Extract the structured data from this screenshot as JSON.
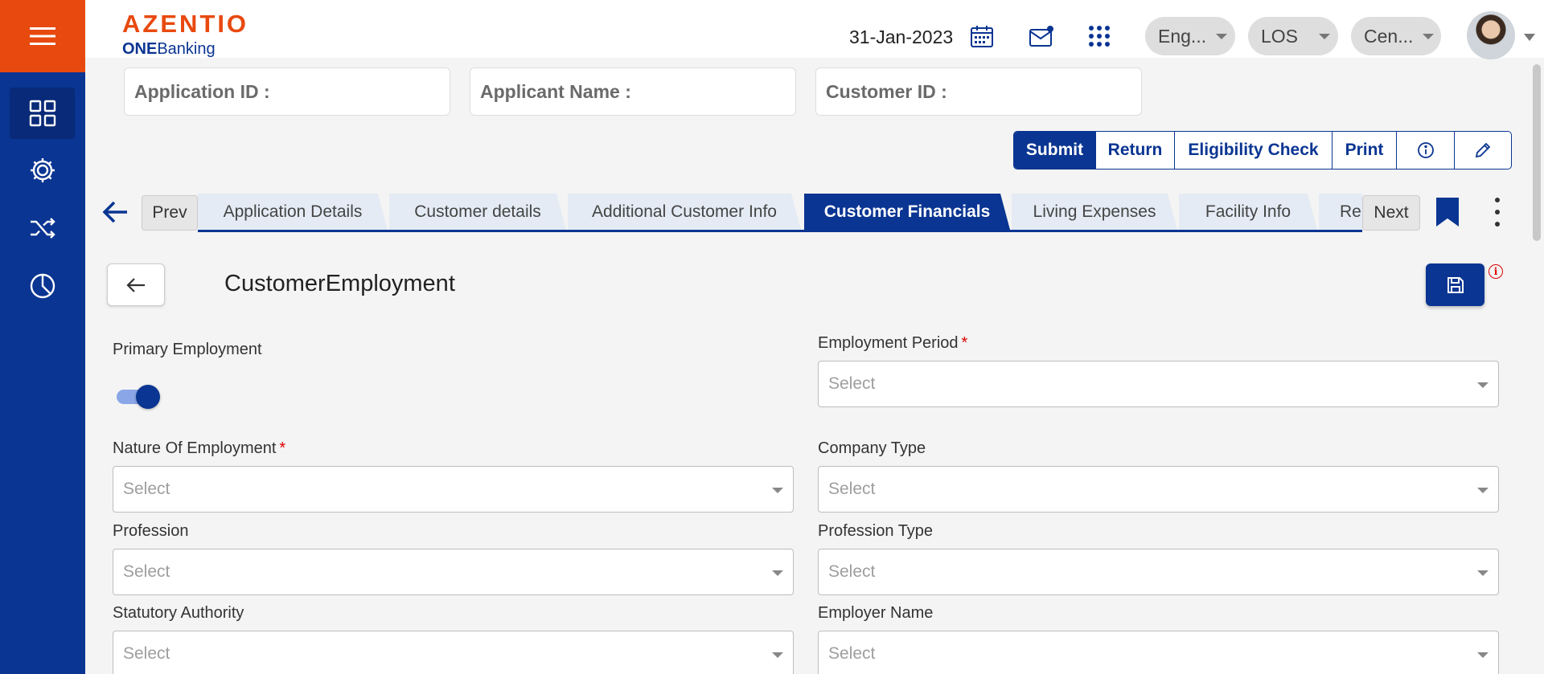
{
  "header": {
    "logo_main": "AZENTIO",
    "logo_sub_bold": "ONE",
    "logo_sub_rest": "Banking",
    "date": "31-Jan-2023",
    "pills": [
      {
        "label": "Eng..."
      },
      {
        "label": "LOS"
      },
      {
        "label": "Cen..."
      }
    ]
  },
  "info_boxes": [
    {
      "label": "Application ID :"
    },
    {
      "label": "Applicant Name :"
    },
    {
      "label": "Customer ID :"
    }
  ],
  "actions": [
    {
      "label": "Submit"
    },
    {
      "label": "Return"
    },
    {
      "label": "Eligibility Check"
    },
    {
      "label": "Print"
    }
  ],
  "nav": {
    "prev_label": "Prev",
    "next_label": "Next"
  },
  "tabs": [
    {
      "label": "Application Details"
    },
    {
      "label": "Customer details"
    },
    {
      "label": "Additional Customer Info"
    },
    {
      "label": "Customer Financials"
    },
    {
      "label": "Living Expenses"
    },
    {
      "label": "Facility Info"
    },
    {
      "label": "Re"
    }
  ],
  "active_tab": "Customer Financials",
  "section": {
    "title": "CustomerEmployment"
  },
  "form": {
    "primary_employment": {
      "label": "Primary Employment",
      "value": true
    },
    "employment_period": {
      "label": "Employment Period",
      "required": true,
      "placeholder": "Select"
    },
    "nature_of_employment": {
      "label": "Nature Of Employment",
      "required": true,
      "placeholder": "Select"
    },
    "company_type": {
      "label": "Company Type",
      "placeholder": "Select"
    },
    "profession": {
      "label": "Profession",
      "placeholder": "Select"
    },
    "profession_type": {
      "label": "Profession Type",
      "placeholder": "Select"
    },
    "statutory_authority": {
      "label": "Statutory Authority",
      "placeholder": "Select"
    },
    "employer_name": {
      "label": "Employer Name",
      "placeholder": "Select"
    },
    "required_mark": "*"
  },
  "colors": {
    "brand_orange": "#e8490f",
    "brand_blue": "#0a3592",
    "required_red": "#d00000"
  }
}
